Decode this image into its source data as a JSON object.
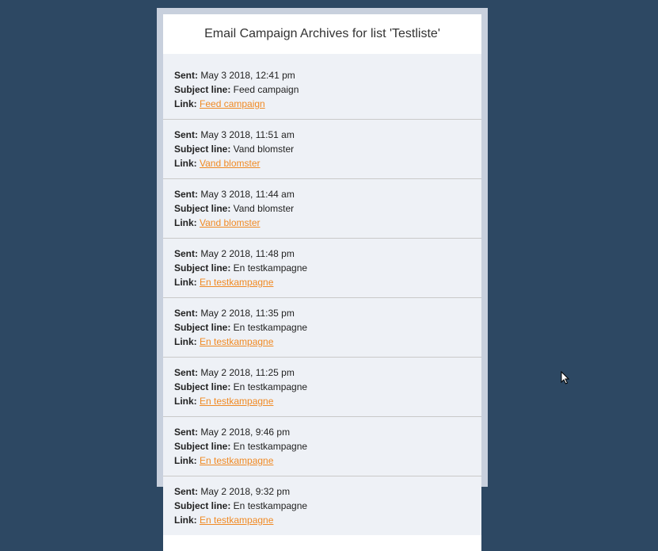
{
  "page_title": "Email Campaign Archives for list 'Testliste'",
  "labels": {
    "sent": "Sent:",
    "subject": "Subject line:",
    "link": "Link:"
  },
  "entries": [
    {
      "sent": "May 3 2018, 12:41 pm",
      "subject": "Feed campaign",
      "link_text": "Feed campaign"
    },
    {
      "sent": "May 3 2018, 11:51 am",
      "subject": "Vand blomster",
      "link_text": "Vand blomster"
    },
    {
      "sent": "May 3 2018, 11:44 am",
      "subject": "Vand blomster",
      "link_text": "Vand blomster"
    },
    {
      "sent": "May 2 2018, 11:48 pm",
      "subject": "En testkampagne",
      "link_text": "En testkampagne"
    },
    {
      "sent": "May 2 2018, 11:35 pm",
      "subject": "En testkampagne",
      "link_text": "En testkampagne"
    },
    {
      "sent": "May 2 2018, 11:25 pm",
      "subject": "En testkampagne",
      "link_text": "En testkampagne"
    },
    {
      "sent": "May 2 2018, 9:46 pm",
      "subject": "En testkampagne",
      "link_text": "En testkampagne"
    },
    {
      "sent": "May 2 2018, 9:32 pm",
      "subject": "En testkampagne",
      "link_text": "En testkampagne"
    }
  ]
}
